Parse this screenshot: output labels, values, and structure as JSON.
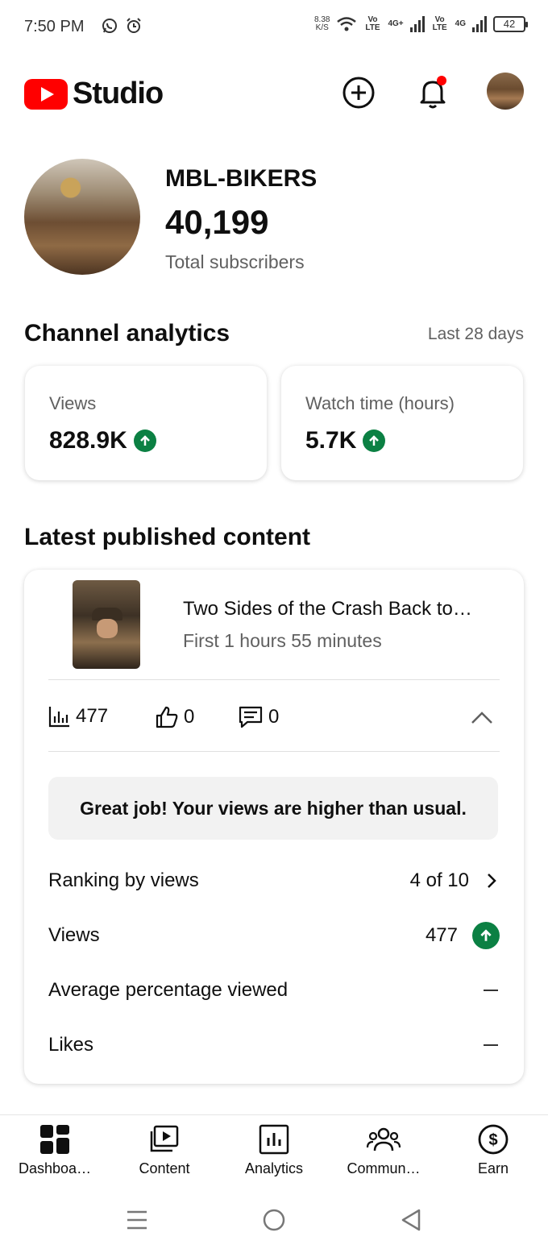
{
  "status_bar": {
    "time": "7:50 PM",
    "speed_value": "8.38",
    "speed_unit": "K/S",
    "sim1_label": "Vo LTE",
    "sim2_label": "Vo LTE",
    "net1": "4G+",
    "net2": "4G",
    "battery": "42"
  },
  "header": {
    "logo_text": "Studio"
  },
  "channel": {
    "name": "MBL-BIKERS",
    "subscribers": "40,199",
    "subscribers_label": "Total subscribers"
  },
  "analytics": {
    "title": "Channel analytics",
    "period": "Last 28 days",
    "cards": [
      {
        "label": "Views",
        "value": "828.9K"
      },
      {
        "label": "Watch time (hours)",
        "value": "5.7K"
      }
    ]
  },
  "latest": {
    "title": "Latest published content",
    "video_title": "Two Sides of the Crash  Back to…",
    "video_subtitle": "First 1 hours 55 minutes",
    "views": "477",
    "likes": "0",
    "comments": "0",
    "callout": "Great job! Your views are higher than usual.",
    "rows": [
      {
        "label": "Ranking by views",
        "value": "4 of 10"
      },
      {
        "label": "Views",
        "value": "477"
      },
      {
        "label": "Average percentage viewed",
        "value": ""
      },
      {
        "label": "Likes",
        "value": ""
      }
    ]
  },
  "bottom_nav": {
    "items": [
      {
        "label": "Dashboa…"
      },
      {
        "label": "Content"
      },
      {
        "label": "Analytics"
      },
      {
        "label": "Commun…"
      },
      {
        "label": "Earn"
      }
    ]
  },
  "colors": {
    "brand_red": "#ff0000",
    "up_green": "#0b8043",
    "notification_dot": "#ff0000"
  },
  "icons": [
    "whatsapp-icon",
    "alarm-icon",
    "wifi-icon",
    "signal-icon",
    "battery-icon",
    "create-icon",
    "bell-icon",
    "analytics-bars-icon",
    "thumbs-up-icon",
    "comment-icon",
    "chevron-up-icon",
    "chevron-right-icon",
    "arrow-up-icon",
    "dashboard-icon",
    "content-icon",
    "analytics-icon",
    "community-icon",
    "earn-icon"
  ]
}
